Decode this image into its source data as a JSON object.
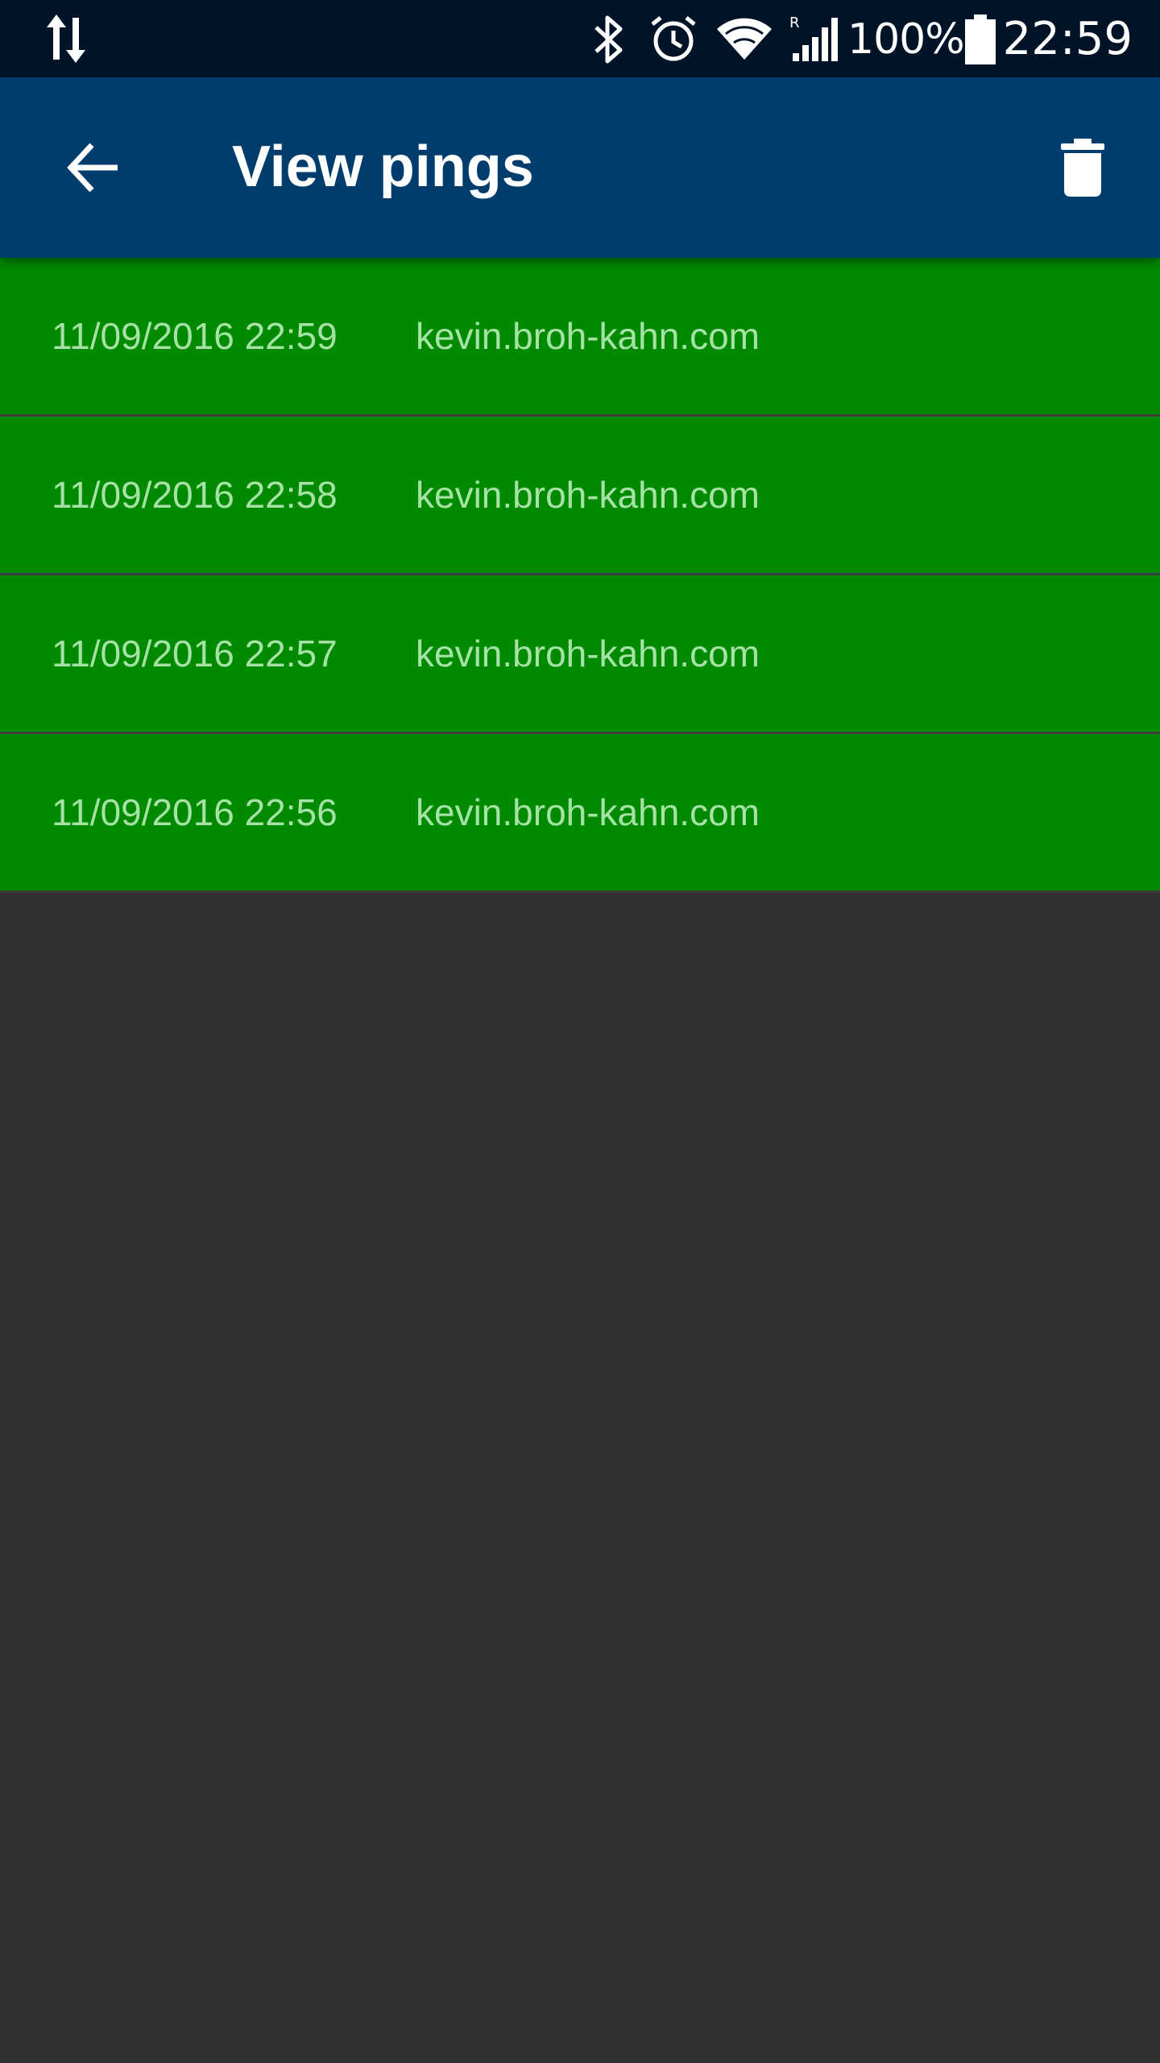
{
  "status_bar": {
    "icons": [
      "data-transfer-icon",
      "bluetooth-icon",
      "alarm-icon",
      "wifi-icon",
      "cell-signal-roaming-icon",
      "battery-icon"
    ],
    "roaming_indicator": "R",
    "battery_percent": "100%",
    "time": "22:59"
  },
  "toolbar": {
    "title": "View pings",
    "back_icon": "arrow-back-icon",
    "delete_icon": "trash-icon"
  },
  "pings": [
    {
      "time": "11/09/2016 22:59",
      "host": "kevin.broh-kahn.com"
    },
    {
      "time": "11/09/2016 22:58",
      "host": "kevin.broh-kahn.com"
    },
    {
      "time": "11/09/2016 22:57",
      "host": "kevin.broh-kahn.com"
    },
    {
      "time": "11/09/2016 22:56",
      "host": "kevin.broh-kahn.com"
    }
  ],
  "colors": {
    "status_bar": "#011427",
    "toolbar": "#003d6d",
    "row_success": "#008a00",
    "row_text": "#a6e2a6",
    "background": "#303030"
  }
}
